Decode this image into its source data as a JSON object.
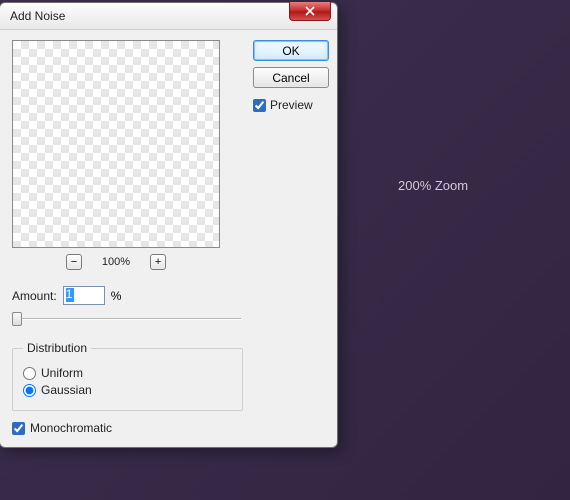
{
  "background": {
    "zoom_label": "200% Zoom"
  },
  "dialog": {
    "title": "Add Noise",
    "buttons": {
      "ok": "OK",
      "cancel": "Cancel"
    },
    "preview_checkbox": {
      "label": "Preview",
      "checked": true
    },
    "preview": {
      "zoom_value": "100%",
      "zoom_out_glyph": "−",
      "zoom_in_glyph": "+"
    },
    "amount": {
      "label": "Amount:",
      "value": "1",
      "unit": "%"
    },
    "distribution": {
      "legend": "Distribution",
      "options": {
        "uniform": "Uniform",
        "gaussian": "Gaussian"
      },
      "selected": "gaussian"
    },
    "monochromatic": {
      "label": "Monochromatic",
      "checked": true
    }
  }
}
